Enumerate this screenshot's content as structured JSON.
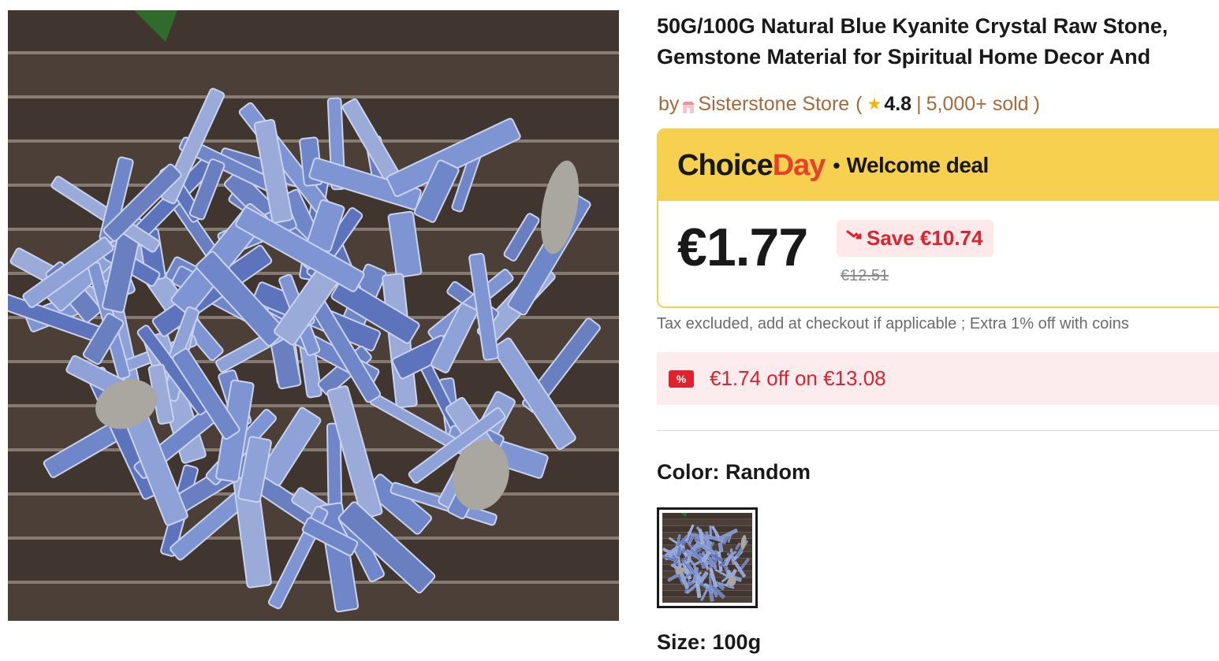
{
  "product": {
    "title": "50G/100G Natural Blue Kyanite Crystal Raw Stone, Gemstone Material for Spiritual Home Decor And Collection",
    "image_alt": "Blue kyanite crystal raw stones on a dark wooden board"
  },
  "store": {
    "by_label": "by",
    "name": "Sisterstone Store",
    "open_paren": "(",
    "rating": "4.8",
    "separator": "|",
    "sold": "5,000+ sold",
    "close_paren": ")"
  },
  "deal": {
    "choice": "Choice",
    "day": "Day",
    "dot": "•",
    "welcome": "Welcome deal",
    "price": "€1.77",
    "save": "Save €10.74",
    "old_price": "€12.51"
  },
  "tax_note": "Tax excluded, add at checkout if applicable ; Extra 1% off with coins",
  "coupon": {
    "icon_text": "%",
    "text": "€1.74 off on €13.08"
  },
  "options": {
    "color_label": "Color: Random",
    "size_label": "Size: 100g"
  },
  "colors": {
    "accent_red": "#e0222f",
    "choice_yellow": "#f7d04f",
    "store_brown": "#a46a3c",
    "star": "#f5b400",
    "stone_blue": "#6f86c9",
    "wood": "#3f342e"
  },
  "icons": [
    "store-icon",
    "star-icon",
    "price-down-icon",
    "coupon-icon"
  ]
}
